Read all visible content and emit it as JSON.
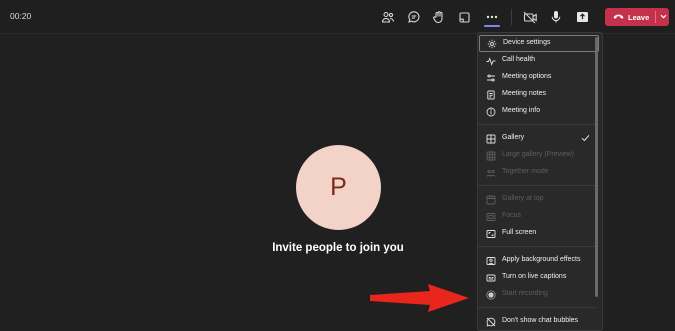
{
  "meeting": {
    "timer": "00:20"
  },
  "toolbar": {
    "icons": [
      "people-icon",
      "chat-icon",
      "reactions-icon",
      "rooms-icon",
      "more-options-icon",
      "camera-off-icon",
      "microphone-icon",
      "share-tray-icon"
    ],
    "leave_label": "Leave",
    "accent": "#7f85f5",
    "leave_color": "#c4314b"
  },
  "stage": {
    "avatar_initial": "P",
    "invite_text": "Invite people to join you",
    "avatar_color": "#f3d3c8"
  },
  "menu": {
    "items": [
      {
        "label": "Device settings",
        "icon": "gear-icon",
        "enabled": true,
        "selected": true
      },
      {
        "label": "Call health",
        "icon": "pulse-icon",
        "enabled": true
      },
      {
        "label": "Meeting options",
        "icon": "sliders-icon",
        "enabled": true
      },
      {
        "label": "Meeting notes",
        "icon": "notes-icon",
        "enabled": true
      },
      {
        "label": "Meeting info",
        "icon": "info-icon",
        "enabled": true
      },
      {
        "label": "Gallery",
        "icon": "gallery-icon",
        "enabled": true,
        "checked": true
      },
      {
        "label": "Large gallery (Preview)",
        "icon": "large-gallery-icon",
        "enabled": false
      },
      {
        "label": "Together mode",
        "icon": "together-mode-icon",
        "enabled": false
      },
      {
        "label": "Gallery at top",
        "icon": "gallery-top-icon",
        "enabled": false
      },
      {
        "label": "Focus",
        "icon": "focus-icon",
        "enabled": false
      },
      {
        "label": "Full screen",
        "icon": "fullscreen-icon",
        "enabled": true
      },
      {
        "label": "Apply background effects",
        "icon": "background-effects-icon",
        "enabled": true
      },
      {
        "label": "Turn on live captions",
        "icon": "captions-icon",
        "enabled": true
      },
      {
        "label": "Start recording",
        "icon": "record-icon",
        "enabled": false
      },
      {
        "label": "Don't show chat bubbles",
        "icon": "chat-bubbles-off-icon",
        "enabled": true
      }
    ]
  },
  "annotation": {
    "arrow_color": "#e8261c"
  }
}
